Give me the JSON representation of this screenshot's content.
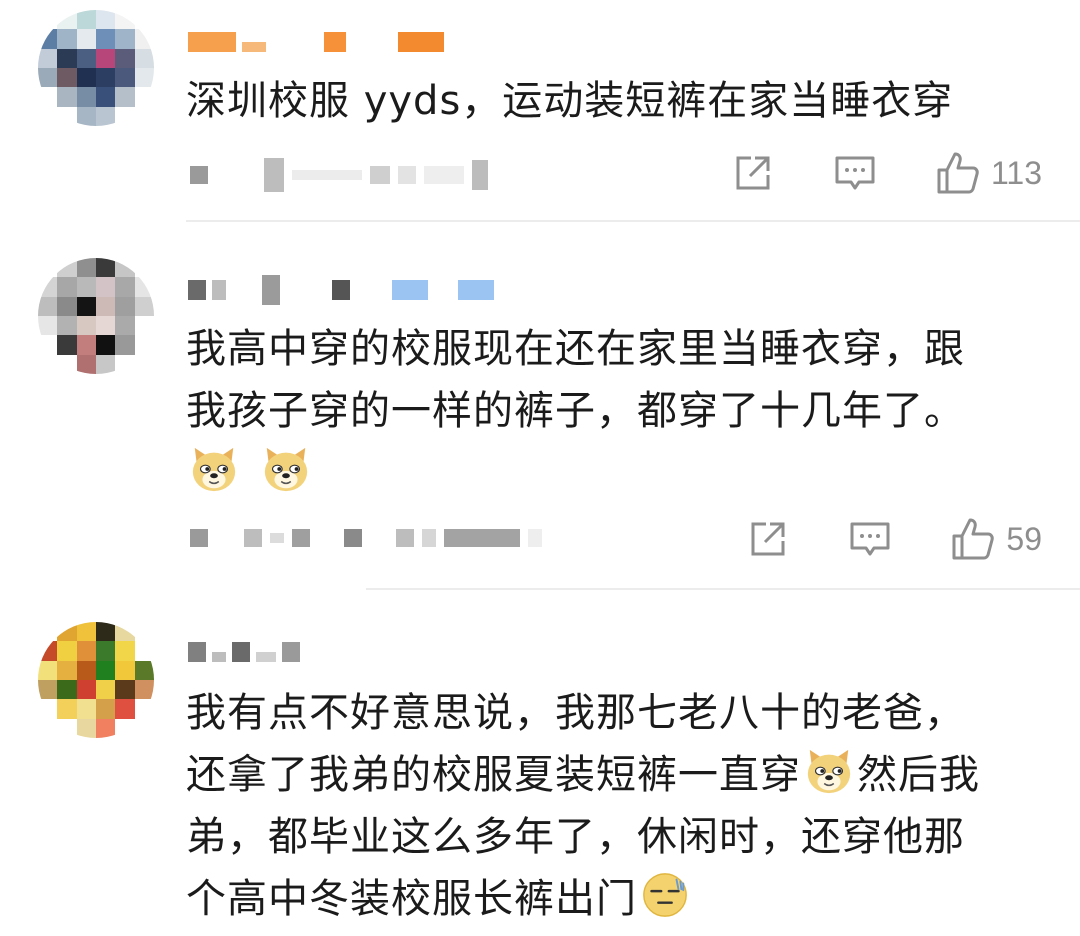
{
  "comments": [
    {
      "text": "深圳校服 yyds，运动装短裤在家当睡衣穿",
      "likes": "113",
      "share_icon": "share-icon",
      "reply_icon": "comment-icon",
      "like_icon": "thumbs-up-icon"
    },
    {
      "text_line1": "我高中穿的校服现在还在家里当睡衣穿，跟",
      "text_line2": "我孩子穿的一样的裤子，都穿了十几年了。",
      "emoji": [
        "doge-emoji",
        "doge-emoji"
      ],
      "likes": "59"
    },
    {
      "text_line1": "我有点不好意思说，我那七老八十的老爸，",
      "text_line2a": "还拿了我弟的校服夏装短裤一直穿",
      "text_line2b": "然后我",
      "text_line3": "弟，都毕业这么多年了，休闲时，还穿他那",
      "text_line4": "个高中冬装校服长裤出门",
      "emoji": [
        "doge-emoji",
        "speechless-emoji"
      ]
    }
  ],
  "colors": {
    "text": "#1b1b1b",
    "icon": "#8e8e8e",
    "divider": "#ececec",
    "verified_blue": "#9cc4f2"
  }
}
